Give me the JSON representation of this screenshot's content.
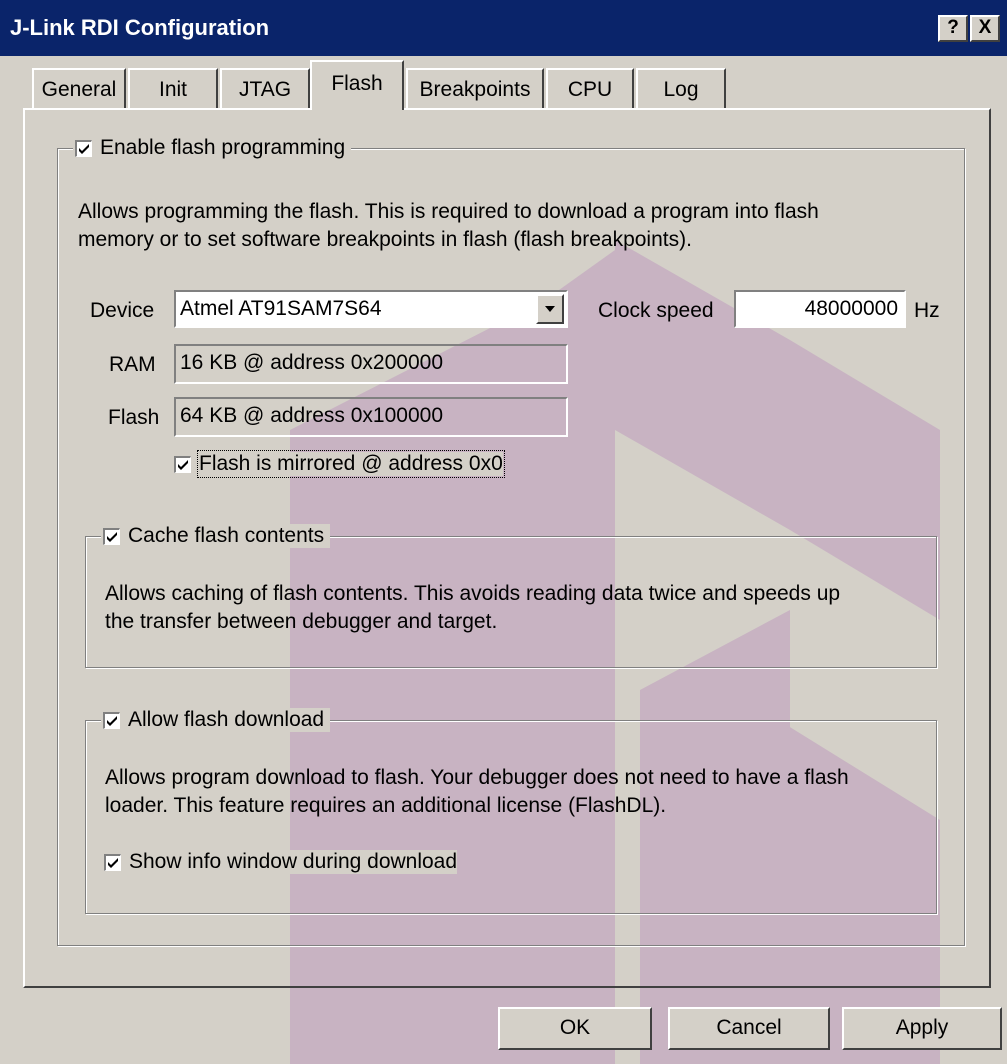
{
  "window": {
    "title": "J-Link RDI Configuration",
    "help_label": "?",
    "close_label": "X"
  },
  "tabs": [
    "General",
    "Init",
    "JTAG",
    "Flash",
    "Breakpoints",
    "CPU",
    "Log"
  ],
  "active_tab": "Flash",
  "flash": {
    "enable_label": "Enable flash programming",
    "enable_checked": true,
    "enable_description_1": "Allows programming the flash. This is required to download a program into flash",
    "enable_description_2": "memory or to set software breakpoints in flash (flash breakpoints).",
    "device_label": "Device",
    "device_value": "Atmel AT91SAM7S64",
    "clock_label": "Clock speed",
    "clock_value": "48000000",
    "clock_unit": "Hz",
    "ram_label": "RAM",
    "ram_value": "16 KB @ address 0x200000",
    "flash_label": "Flash",
    "flash_value": "64 KB @ address 0x100000",
    "mirrored_label": "Flash is mirrored @ address 0x0",
    "mirrored_checked": true
  },
  "cache": {
    "label": "Cache flash contents",
    "checked": true,
    "description_1": "Allows caching of flash contents. This avoids reading data twice and speeds up",
    "description_2": "the transfer between debugger and target."
  },
  "download": {
    "label": "Allow flash download",
    "checked": true,
    "description_1": "Allows program download to flash. Your debugger does not need to have a flash",
    "description_2": "loader. This feature requires an additional license (FlashDL).",
    "show_info_label": "Show info window during download",
    "show_info_checked": true
  },
  "buttons": {
    "ok": "OK",
    "cancel": "Cancel",
    "apply": "Apply"
  },
  "colors": {
    "titlebar": "#0a246a",
    "face": "#d4d0c8",
    "watermark": "#c08cc8"
  }
}
